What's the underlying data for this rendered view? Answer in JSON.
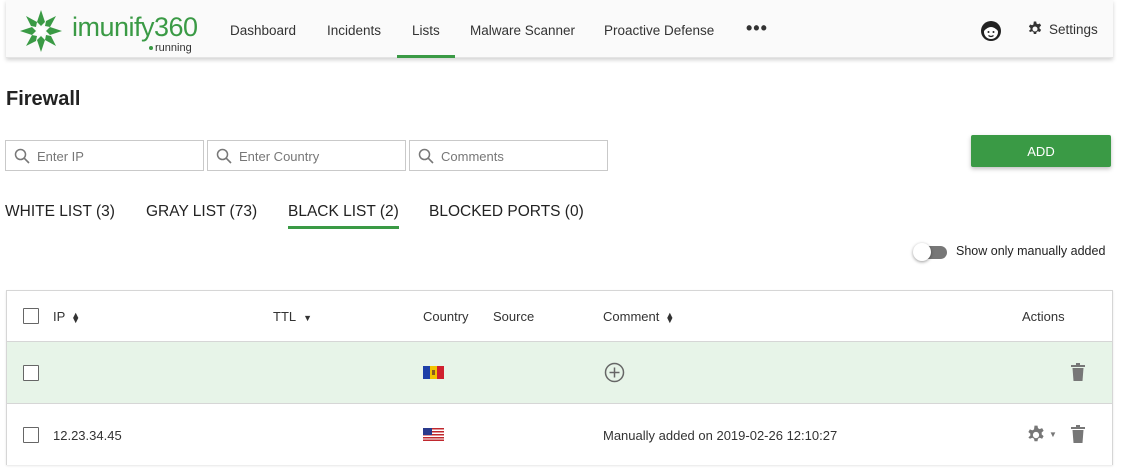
{
  "app": {
    "logo_word": "imunify360",
    "logo_status": "running",
    "brand_color": "#3a9a45"
  },
  "nav": {
    "items": [
      {
        "label": "Dashboard",
        "active": false
      },
      {
        "label": "Incidents",
        "active": false
      },
      {
        "label": "Lists",
        "active": true
      },
      {
        "label": "Malware Scanner",
        "active": false
      },
      {
        "label": "Proactive Defense",
        "active": false
      }
    ],
    "more_label": "•••",
    "support_icon": "support-agent-icon",
    "settings_label": "Settings",
    "settings_icon": "gear-icon"
  },
  "page": {
    "title": "Firewall"
  },
  "filters": {
    "ip_placeholder": "Enter IP",
    "country_placeholder": "Enter Country",
    "comments_placeholder": "Comments",
    "icon": "search-icon"
  },
  "add_button": "ADD",
  "tabs": [
    {
      "label": "WHITE LIST (3)",
      "active": false
    },
    {
      "label": "GRAY LIST (73)",
      "active": false
    },
    {
      "label": "BLACK LIST (2)",
      "active": true
    },
    {
      "label": "BLOCKED PORTS (0)",
      "active": false
    }
  ],
  "toggle": {
    "label": "Show only manually added",
    "on": false
  },
  "table": {
    "columns": {
      "ip": "IP",
      "ttl": "TTL",
      "country": "Country",
      "source": "Source",
      "comment": "Comment",
      "actions": "Actions"
    },
    "rows": [
      {
        "ip": "",
        "country_flag": "Moldova",
        "comment": "",
        "comment_icon": "add-circle-icon",
        "actions": [
          "trash-icon"
        ],
        "highlighted": true
      },
      {
        "ip": "12.23.34.45",
        "country_flag": "United States",
        "comment": "Manually added on 2019-02-26 12:10:27",
        "actions": [
          "gear-icon",
          "trash-icon"
        ],
        "highlighted": false
      }
    ]
  }
}
